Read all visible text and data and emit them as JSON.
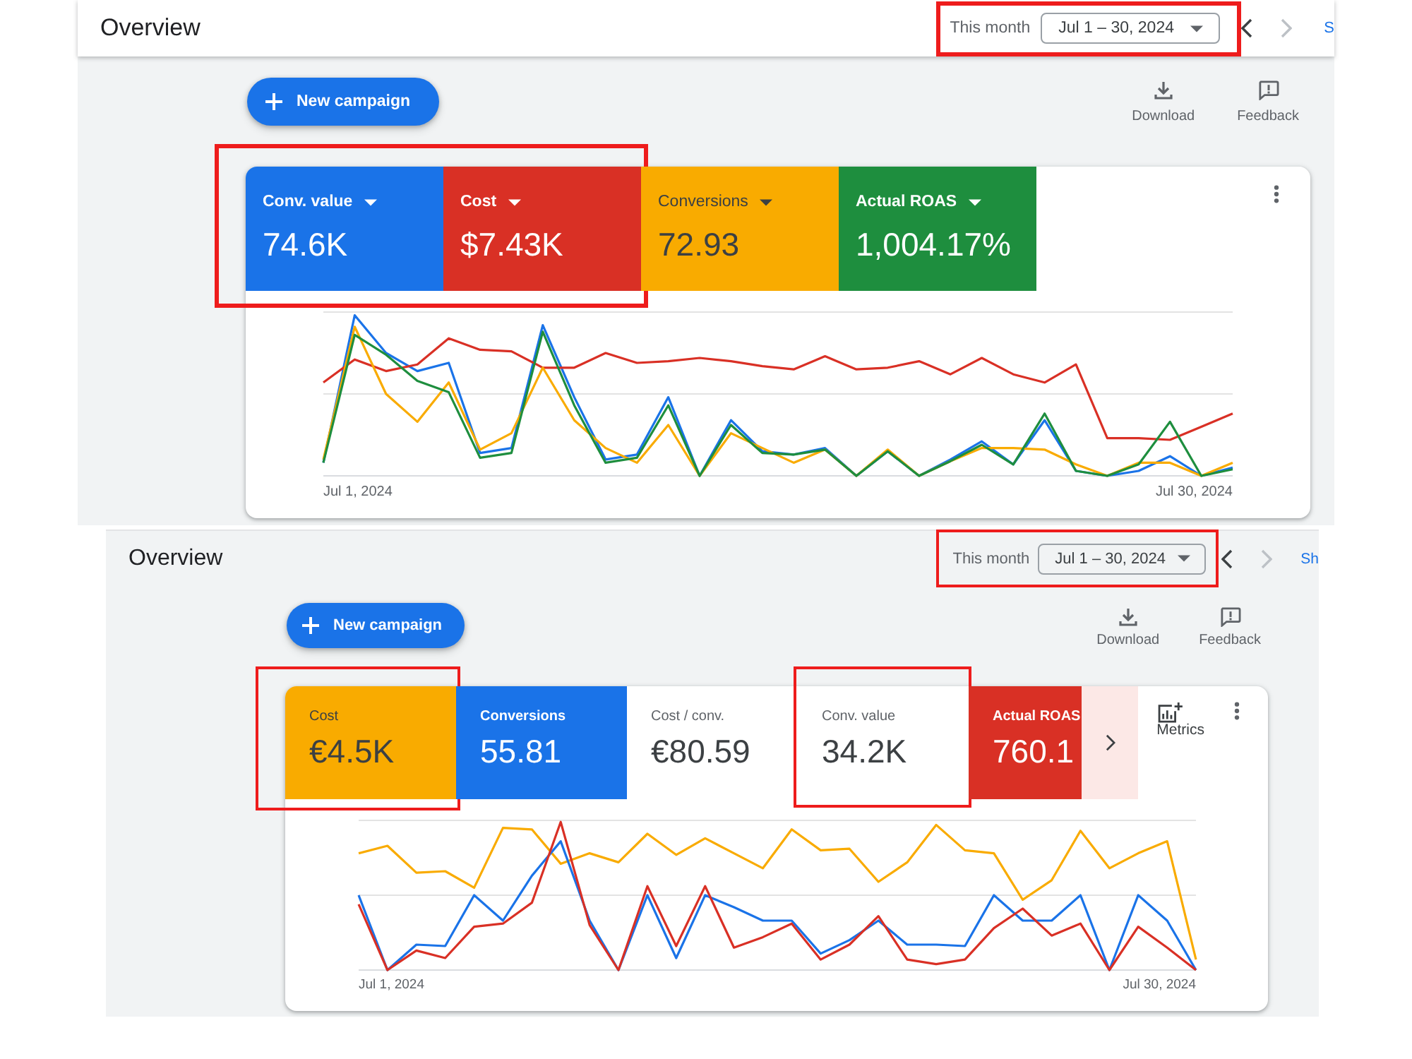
{
  "panels": [
    {
      "header": {
        "title": "Overview",
        "period_label": "This month",
        "date_range": "Jul 1 – 30, 2024",
        "date_highlighted": true,
        "nav": [
          {
            "kind": "prev",
            "disabled": false
          },
          {
            "kind": "next",
            "disabled": true
          }
        ],
        "link": "S"
      },
      "new_campaign": "New campaign",
      "actions": [
        {
          "kind": "download",
          "label": "Download"
        },
        {
          "kind": "feedback",
          "label": "Feedback"
        }
      ],
      "tiles": [
        {
          "label": "Conv. value",
          "value": "74.6K",
          "selected": true,
          "color": "#1a73e8",
          "dropdown": true,
          "highlighted": true
        },
        {
          "label": "Cost",
          "value": "$7.43K",
          "selected": true,
          "color": "#d93025",
          "dropdown": true,
          "highlighted": true
        },
        {
          "label": "Conversions",
          "value": "72.93",
          "selected": true,
          "color": "#f9ab00",
          "dropdown": true,
          "highlighted": false
        },
        {
          "label": "Actual ROAS",
          "value": "1,004.17%",
          "selected": true,
          "color": "#1e8e3e",
          "dropdown": true,
          "highlighted": false
        }
      ],
      "chart": {
        "start_label": "Jul 1, 2024",
        "end_label": "Jul 30, 2024"
      }
    },
    {
      "header": {
        "title": "Overview",
        "period_label": "This month",
        "date_range": "Jul 1 – 30, 2024",
        "date_highlighted": true,
        "nav": [
          {
            "kind": "prev",
            "disabled": false
          },
          {
            "kind": "next",
            "disabled": true
          }
        ],
        "link": "Sh"
      },
      "new_campaign": "New campaign",
      "actions": [
        {
          "kind": "download",
          "label": "Download"
        },
        {
          "kind": "feedback",
          "label": "Feedback"
        }
      ],
      "tiles": [
        {
          "label": "Cost",
          "value": "€4.5K",
          "selected": true,
          "color": "#f9ab00",
          "dropdown": false,
          "highlighted": true
        },
        {
          "label": "Conversions",
          "value": "55.81",
          "selected": true,
          "color": "#1a73e8",
          "dropdown": false,
          "highlighted": false
        },
        {
          "label": "Cost / conv.",
          "value": "€80.59",
          "selected": false,
          "dropdown": false,
          "highlighted": false
        },
        {
          "label": "Conv. value",
          "value": "34.2K",
          "selected": false,
          "dropdown": false,
          "highlighted": true
        },
        {
          "label": "Actual ROAS",
          "value": "760.1",
          "selected": true,
          "color": "#d93025",
          "dropdown": false,
          "highlighted": false
        }
      ],
      "more_tiles": true,
      "metrics_button": "Metrics",
      "chart": {
        "start_label": "Jul 1, 2024",
        "end_label": "Jul 30, 2024"
      }
    }
  ]
}
